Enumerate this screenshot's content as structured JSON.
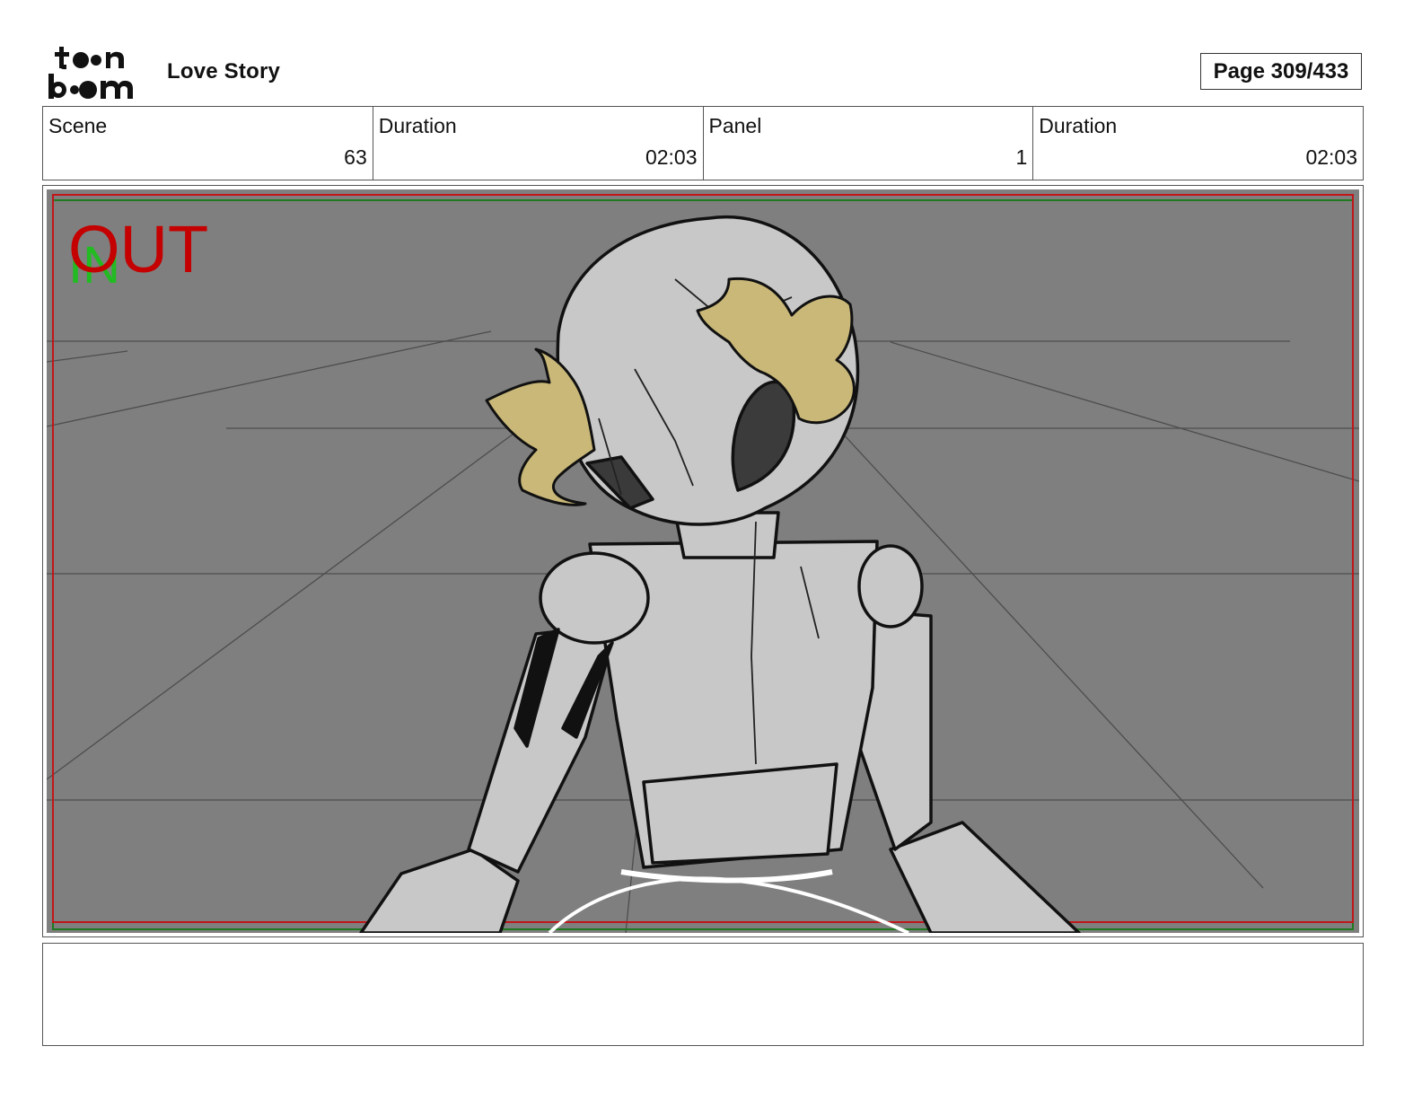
{
  "header": {
    "logo_text": "toonboom",
    "project_title": "Love Story",
    "page_indicator": "Page 309/433"
  },
  "info": {
    "scene_label": "Scene",
    "scene_value": "63",
    "scene_duration_label": "Duration",
    "scene_duration_value": "02:03",
    "panel_label": "Panel",
    "panel_value": "1",
    "panel_duration_label": "Duration",
    "panel_duration_value": "02:03"
  },
  "panel": {
    "in_marker": "IN",
    "out_marker": "OUT",
    "colors": {
      "background": "#7f7f7f",
      "safe_frame": "#c0161a",
      "title_safe": "#1f7a1f",
      "in_marker": "#22bb22",
      "out_marker": "#c40000",
      "character_fill": "#c8c8c8",
      "flower": "#c9b878"
    }
  },
  "caption": {
    "text": ""
  }
}
